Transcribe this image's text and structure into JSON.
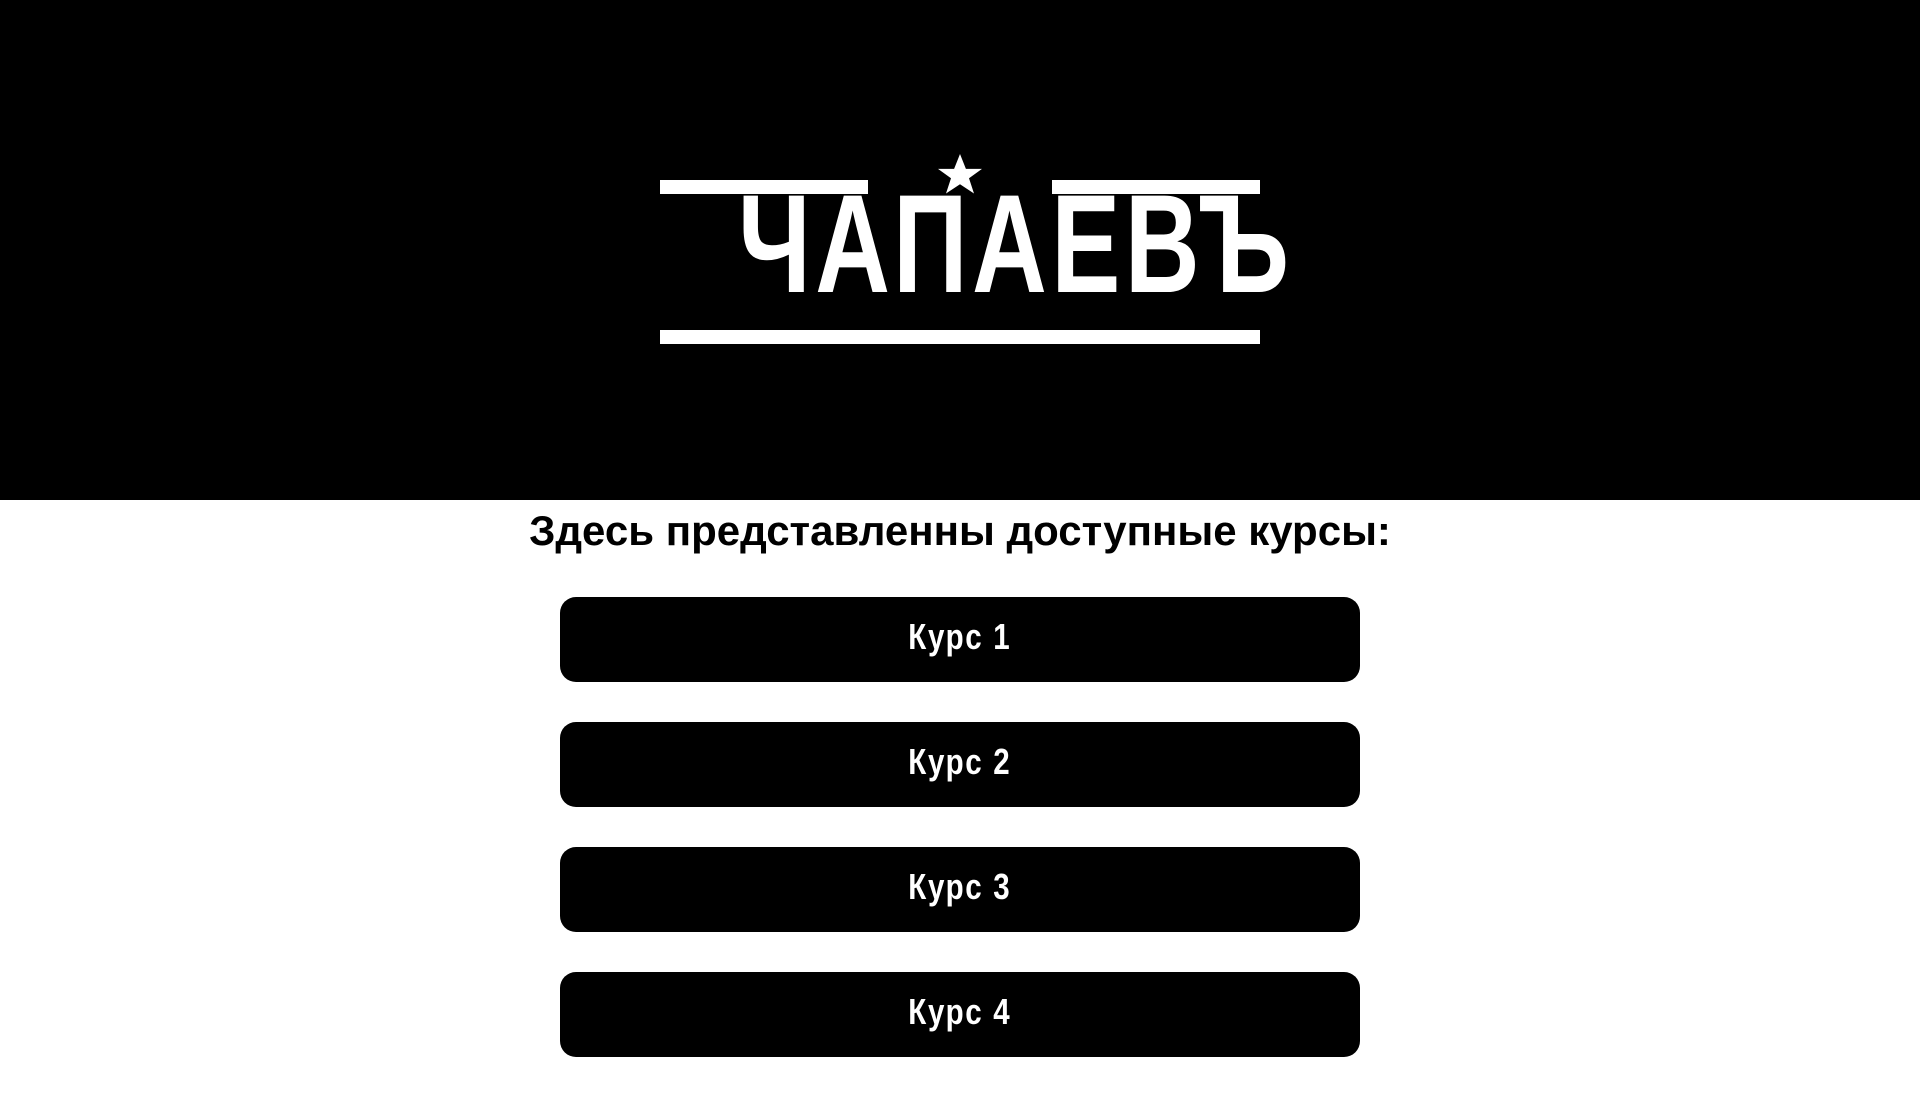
{
  "header": {
    "logo_text": "ЧАПАЕВЪ",
    "background": "#000000",
    "logo_color": "#ffffff",
    "logo_icon": "star-icon"
  },
  "main": {
    "subtitle": "Здесь представленны доступные курсы:",
    "courses": [
      {
        "label": "Курс 1"
      },
      {
        "label": "Курс 2"
      },
      {
        "label": "Курс 3"
      },
      {
        "label": "Курс 4"
      }
    ],
    "button_color": "#000000",
    "button_text_color": "#ffffff"
  }
}
